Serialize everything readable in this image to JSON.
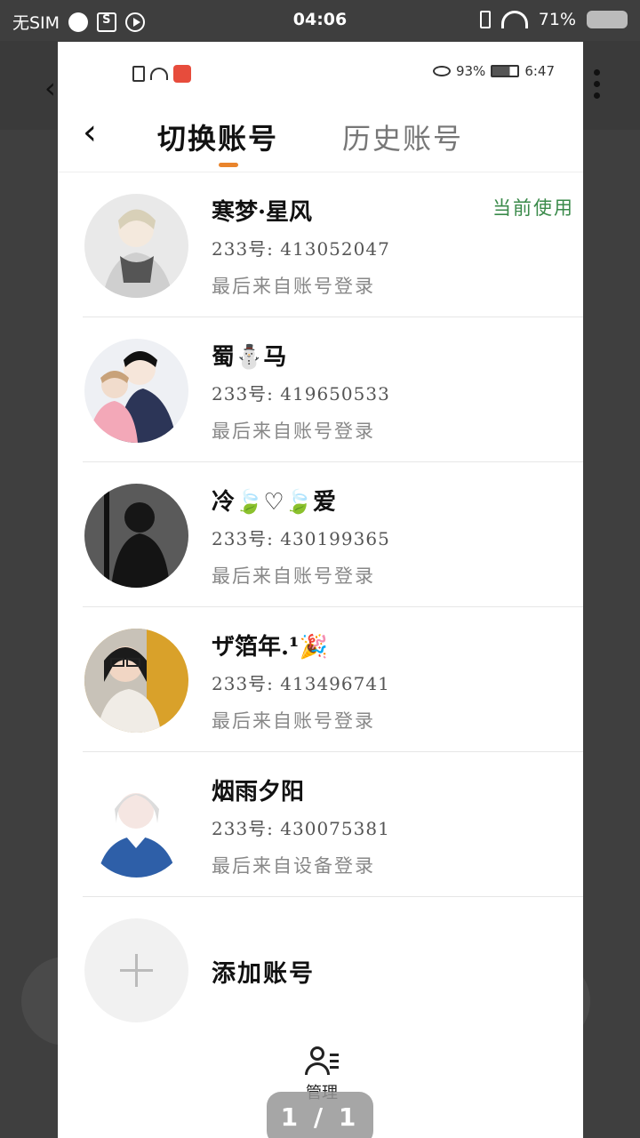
{
  "device_status": {
    "carrier": "无SIM",
    "time": "04:06",
    "battery": "71%"
  },
  "inner_status": {
    "eye_percent": "93%",
    "time": "6:47"
  },
  "header": {
    "tab_active": "切换账号",
    "tab_history": "历史账号"
  },
  "accounts": [
    {
      "name": "寒梦·星风",
      "uid": "233号: 413052047",
      "source": "最后来自账号登录",
      "current": "当前使用"
    },
    {
      "name": "蜀⛄马",
      "uid": "233号: 419650533",
      "source": "最后来自账号登录"
    },
    {
      "name": "冷🍃♡🍃爱",
      "uid": "233号: 430199365",
      "source": "最后来自账号登录"
    },
    {
      "name": "ザ箔年.¹🎉",
      "uid": "233号: 413496741",
      "source": "最后来自账号登录"
    },
    {
      "name": "烟雨夕阳",
      "uid": "233号: 430075381",
      "source": "最后来自设备登录"
    }
  ],
  "add_account": {
    "label": "添加账号"
  },
  "manage": {
    "label": "管理"
  },
  "pager": {
    "text": "1 / 1"
  },
  "colors": {
    "accent": "#e9842c",
    "current_green": "#3a8a4a"
  }
}
